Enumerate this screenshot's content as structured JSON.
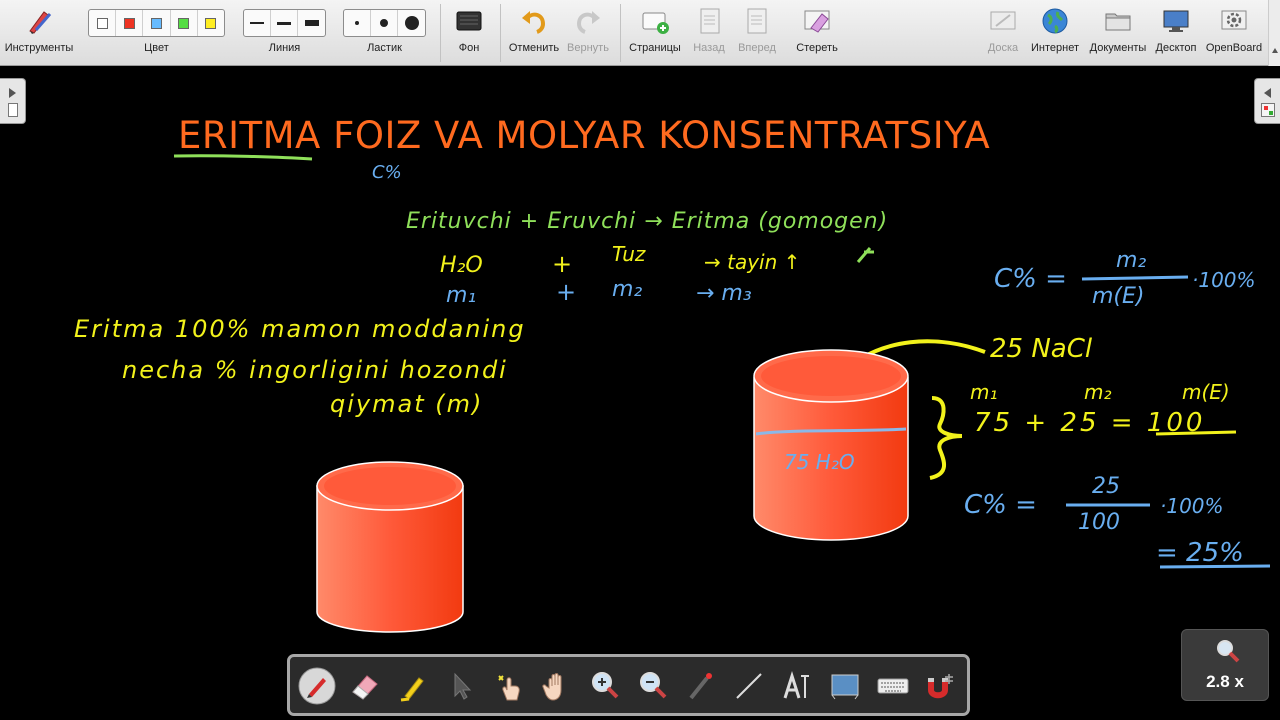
{
  "toolbar": {
    "tools_label": "Инструменты",
    "color_label": "Цвет",
    "colors": [
      "#ffffff",
      "#ee3322",
      "#66bbff",
      "#55dd44",
      "#ffee22"
    ],
    "line_label": "Линия",
    "eraser_label": "Ластик",
    "background_label": "Фон",
    "undo_label": "Отменить",
    "redo_label": "Вернуть",
    "pages_label": "Страницы",
    "back_label": "Назад",
    "forward_label": "Вперед",
    "erase_label": "Стереть",
    "board_label": "Доска",
    "internet_label": "Интернет",
    "documents_label": "Документы",
    "desktop_label": "Десктоп",
    "openboard_label": "OpenBoard"
  },
  "board": {
    "title": "ERITMA FOIZ VA MOLYAR KONSENTRATSIYA",
    "notes": {
      "c_percent": "C%",
      "line1": "Erituvchi + Eruvchi → Eritma (gomogen)",
      "line2_left": "H₂O",
      "line2_plus": "+",
      "line2_mid": "Tuz",
      "line2_right": "→ tayin ↑",
      "line3_m1": "m₁",
      "line3_plus": "+",
      "line3_m2": "m₂",
      "line3_m3": "→ m₃",
      "yellow1": "Eritma 100% mamon moddaning",
      "yellow2": "necha % ingorligini hozondi",
      "yellow3": "qiymat (m)",
      "formula_c": "C% =",
      "formula_num": "m₂",
      "formula_den": "m(E)",
      "formula_tail": "·100%",
      "nacl_label": "25 NaCl",
      "m1_hdr": "m₁",
      "m2_hdr": "m₂",
      "me_hdr": "m(E)",
      "sum_eq": "75 + 25 = 100",
      "h2o_label": "75 H₂O",
      "calc_c": "C% =",
      "calc_num": "25",
      "calc_den": "100",
      "calc_tail": "·100%",
      "result": "= 25%"
    }
  },
  "zoom": {
    "value": "2.8 x"
  }
}
